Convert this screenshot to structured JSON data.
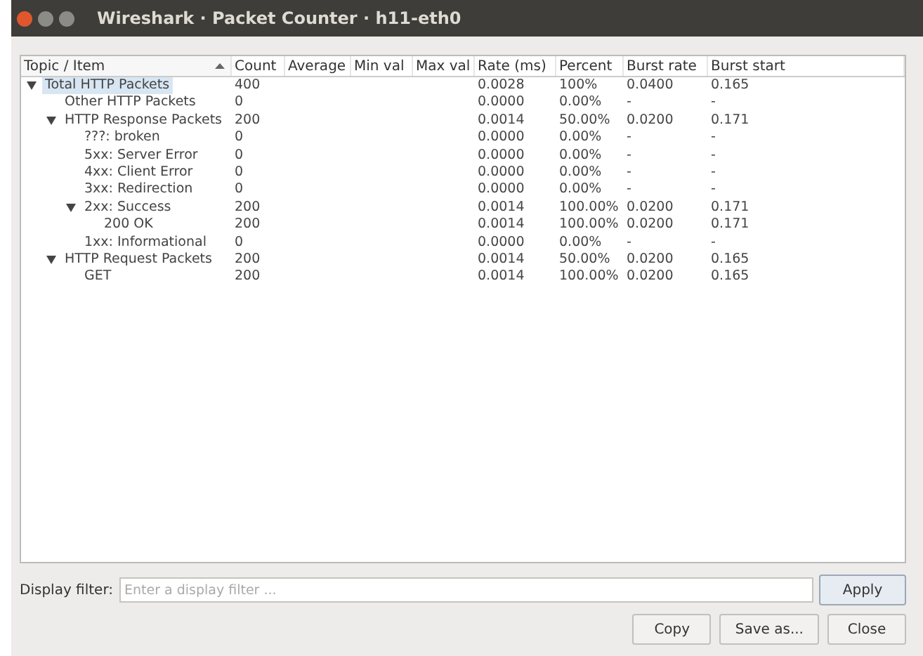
{
  "window": {
    "title": "Wireshark · Packet Counter · h11-eth0"
  },
  "table": {
    "columns": [
      {
        "label": "Topic / Item",
        "sorted": true
      },
      {
        "label": "Count",
        "sorted": false
      },
      {
        "label": "Average",
        "sorted": false
      },
      {
        "label": "Min val",
        "sorted": false
      },
      {
        "label": "Max val",
        "sorted": false
      },
      {
        "label": "Rate (ms)",
        "sorted": false
      },
      {
        "label": "Percent",
        "sorted": false
      },
      {
        "label": "Burst rate",
        "sorted": false
      },
      {
        "label": "Burst start",
        "sorted": false
      }
    ],
    "rows": [
      {
        "label": "Total HTTP Packets",
        "count": "400",
        "rate": "0.0028",
        "percent": "100%",
        "burst_rate": "0.0400",
        "burst_start": "0.165",
        "selected": true,
        "expanded": true,
        "children": [
          {
            "label": "Other HTTP Packets",
            "count": "0",
            "rate": "0.0000",
            "percent": "0.00%",
            "burst_rate": "-",
            "burst_start": "-",
            "selected": false
          },
          {
            "label": "HTTP Response Packets",
            "count": "200",
            "rate": "0.0014",
            "percent": "50.00%",
            "burst_rate": "0.0200",
            "burst_start": "0.171",
            "selected": false,
            "expanded": true,
            "children": [
              {
                "label": "???: broken",
                "count": "0",
                "rate": "0.0000",
                "percent": "0.00%",
                "burst_rate": "-",
                "burst_start": "-",
                "selected": false
              },
              {
                "label": "5xx: Server Error",
                "count": "0",
                "rate": "0.0000",
                "percent": "0.00%",
                "burst_rate": "-",
                "burst_start": "-",
                "selected": false
              },
              {
                "label": "4xx: Client Error",
                "count": "0",
                "rate": "0.0000",
                "percent": "0.00%",
                "burst_rate": "-",
                "burst_start": "-",
                "selected": false
              },
              {
                "label": "3xx: Redirection",
                "count": "0",
                "rate": "0.0000",
                "percent": "0.00%",
                "burst_rate": "-",
                "burst_start": "-",
                "selected": false
              },
              {
                "label": "2xx: Success",
                "count": "200",
                "rate": "0.0014",
                "percent": "100.00%",
                "burst_rate": "0.0200",
                "burst_start": "0.171",
                "selected": false,
                "expanded": true,
                "children": [
                  {
                    "label": "200 OK",
                    "count": "200",
                    "rate": "0.0014",
                    "percent": "100.00%",
                    "burst_rate": "0.0200",
                    "burst_start": "0.171",
                    "selected": false
                  }
                ]
              },
              {
                "label": "1xx: Informational",
                "count": "0",
                "rate": "0.0000",
                "percent": "0.00%",
                "burst_rate": "-",
                "burst_start": "-",
                "selected": false
              }
            ]
          },
          {
            "label": "HTTP Request Packets",
            "count": "200",
            "rate": "0.0014",
            "percent": "50.00%",
            "burst_rate": "0.0200",
            "burst_start": "0.165",
            "selected": false,
            "expanded": true,
            "children": [
              {
                "label": "GET",
                "count": "200",
                "rate": "0.0014",
                "percent": "100.00%",
                "burst_rate": "0.0200",
                "burst_start": "0.165",
                "selected": false
              }
            ]
          }
        ]
      }
    ]
  },
  "filter": {
    "label": "Display filter:",
    "placeholder": "Enter a display filter ..."
  },
  "buttons": {
    "apply": "Apply",
    "bottom": [
      "Copy",
      "Save as...",
      "Close"
    ]
  }
}
